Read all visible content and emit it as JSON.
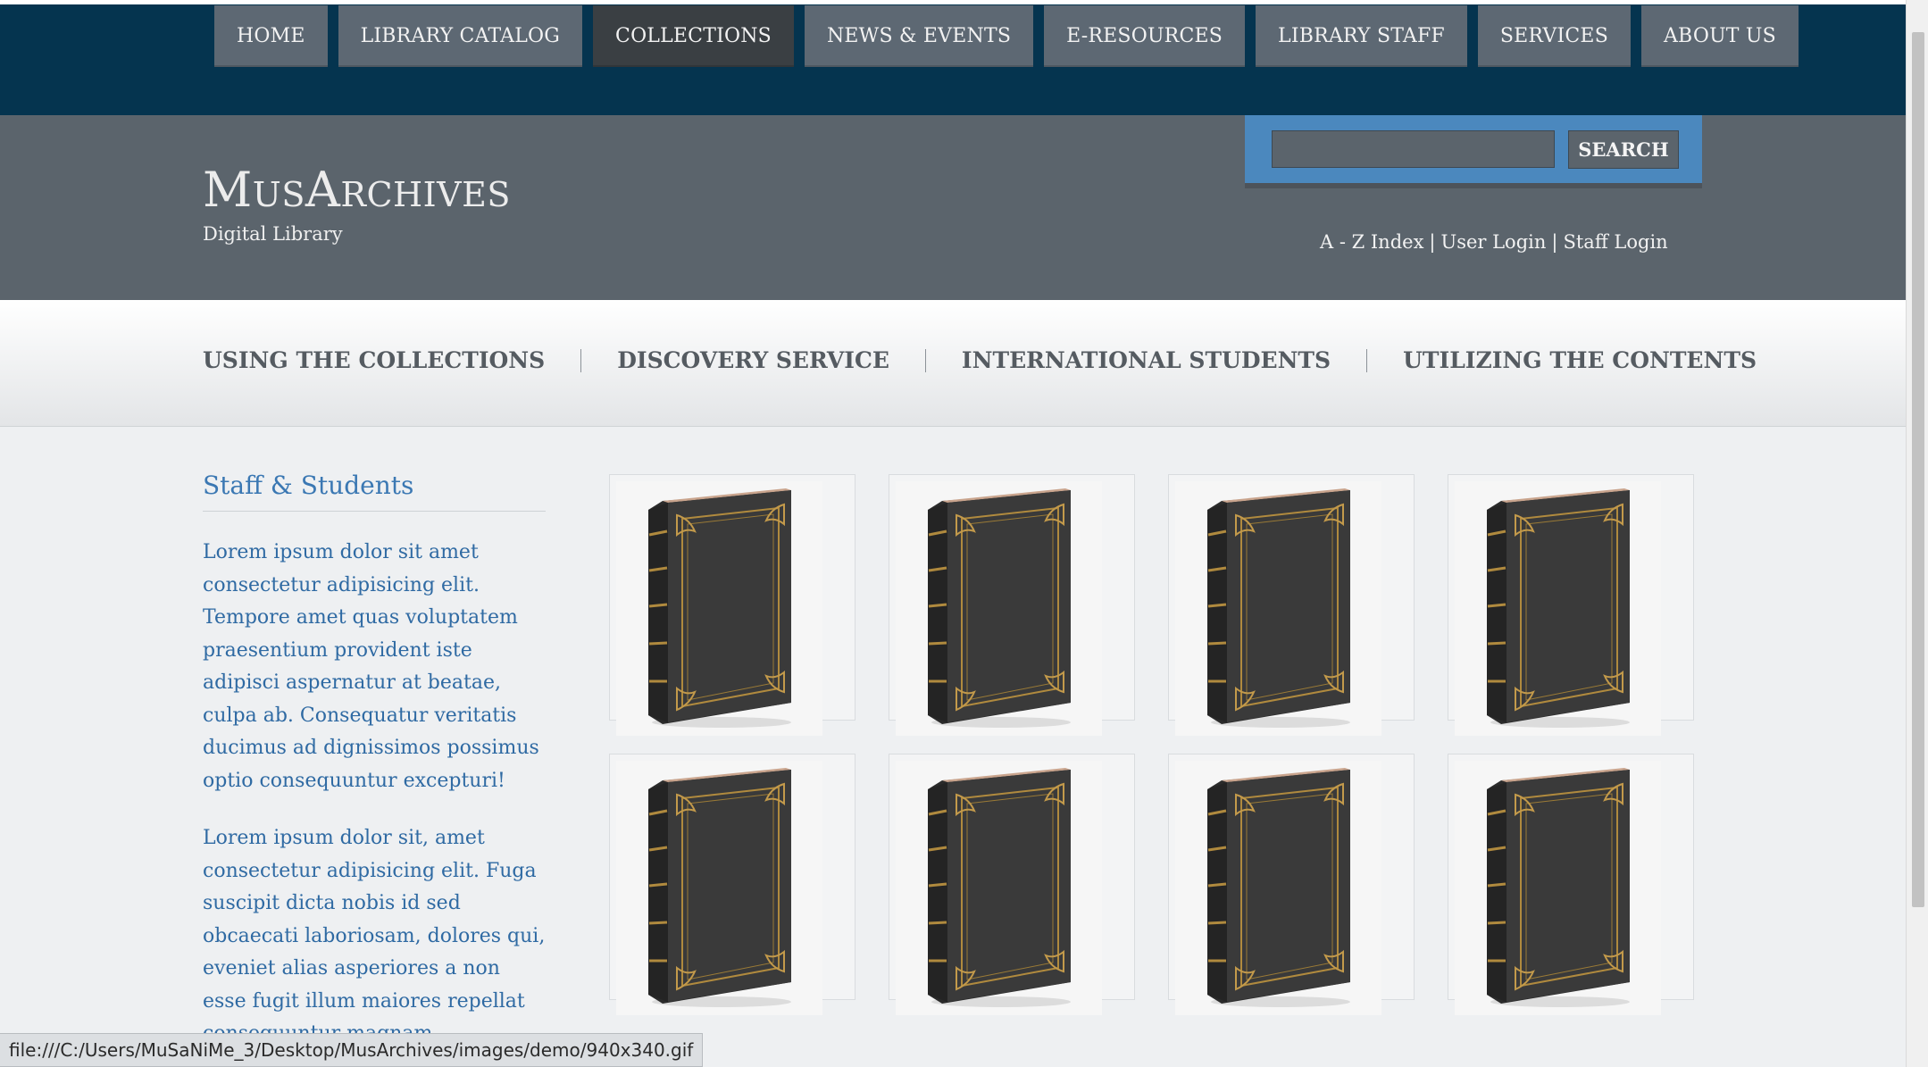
{
  "topnav": {
    "items": [
      "HOME",
      "LIBRARY CATALOG",
      "COLLECTIONS",
      "NEWS & EVENTS",
      "E-RESOURCES",
      "LIBRARY STAFF",
      "SERVICES",
      "ABOUT US"
    ],
    "active": "COLLECTIONS"
  },
  "header": {
    "logo": "MusArchives",
    "tagline": "Digital Library",
    "search": {
      "placeholder": "",
      "button": "SEARCH"
    },
    "links": [
      "A - Z Index",
      "User Login",
      "Staff Login"
    ]
  },
  "subnav": {
    "items": [
      "USING THE COLLECTIONS",
      "DISCOVERY SERVICE",
      "INTERNATIONAL STUDENTS",
      "UTILIZING THE CONTENTS"
    ]
  },
  "sidebar": {
    "title": "Staff & Students",
    "paragraphs": [
      "Lorem ipsum dolor sit amet consectetur adipisicing elit. Tempore amet quas voluptatem praesentium provident iste adipisci aspernatur at beatae, culpa ab. Consequatur veritatis ducimus ad dignissimos possimus optio consequuntur excepturi!",
      "Lorem ipsum dolor sit, amet consectetur adipisicing elit. Fuga suscipit dicta nobis id sed obcaecati laboriosam, dolores qui, eveniet alias asperiores a non esse fugit illum maiores repellat consequuntur magnam."
    ]
  },
  "gallery": {
    "item_icon": "book-icon",
    "count": 8
  },
  "statusbar": {
    "text": "file:///C:/Users/MuSaNiMe_3/Desktop/MusArchives/images/demo/940x340.gif"
  },
  "colors": {
    "topnav_bg": "#05344f",
    "header_bg": "#5b646c",
    "search_accent": "#4b88be",
    "link_blue": "#3b78b3"
  }
}
